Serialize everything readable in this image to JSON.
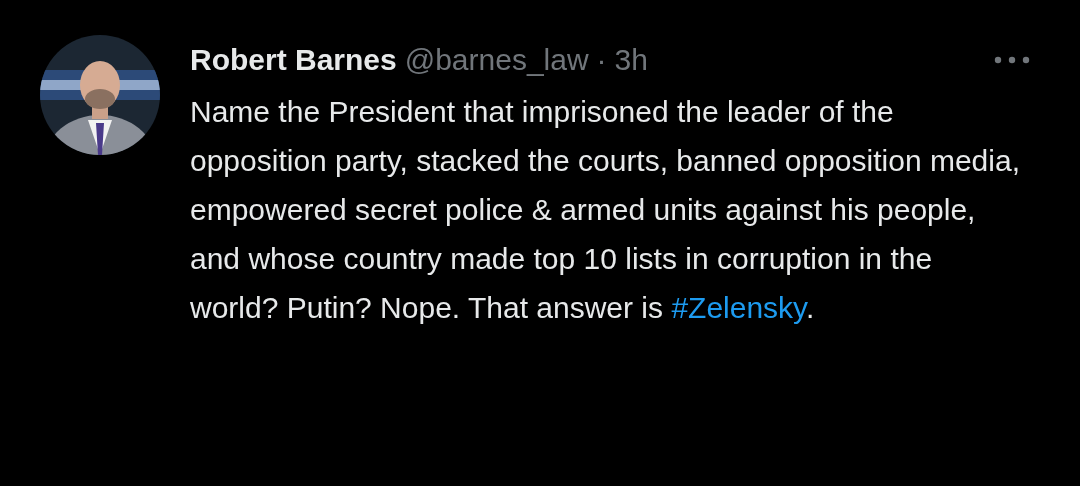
{
  "tweet": {
    "author": {
      "name": "Robert Barnes",
      "handle": "@barnes_law",
      "separator": "·",
      "time": "3h"
    },
    "text": "Name the President that imprisoned the leader of the opposition party, stacked the courts, banned opposition media, empowered secret police & armed units against his people, and whose country made top 10 lists in corruption in the world? Putin? Nope. That answer is ",
    "hashtag": "#Zelensky",
    "text_after": "."
  }
}
